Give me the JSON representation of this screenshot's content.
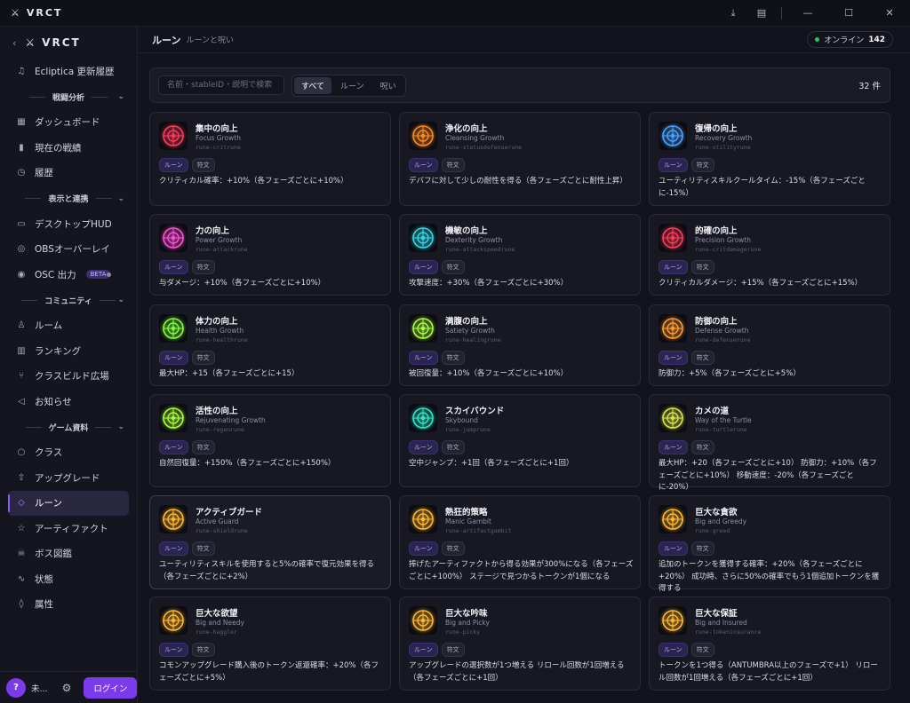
{
  "window": {
    "title": "VRCT"
  },
  "sidebar": {
    "brand": "VRCT",
    "top_item": "Ecliptica 更新履歴",
    "sections": [
      {
        "title": "戦闘分析",
        "items": [
          "ダッシュボード",
          "現在の戦績",
          "履歴"
        ]
      },
      {
        "title": "表示と連携",
        "items": [
          "デスクトップHUD",
          "OBSオーバーレイ",
          "OSC 出力"
        ]
      },
      {
        "title": "コミュニティ",
        "items": [
          "ルーム",
          "ランキング",
          "クラスビルド広場",
          "お知らせ"
        ]
      },
      {
        "title": "ゲーム資料",
        "items": [
          "クラス",
          "アップグレード",
          "ルーン",
          "アーティファクト",
          "ボス図鑑",
          "状態",
          "属性"
        ]
      }
    ],
    "beta_badge": "BETA",
    "footer": {
      "avatar": "?",
      "user": "未...",
      "login": "ログイン"
    }
  },
  "header": {
    "title": "ルーン",
    "subtitle": "ルーンと呪い",
    "online_label": "オンライン",
    "online_count": "142"
  },
  "filter": {
    "placeholder": "名前・stableID・説明で検索",
    "segments": [
      "すべて",
      "ルーン",
      "呪い"
    ],
    "count": "32 件"
  },
  "tag_labels": {
    "rune": "ルーン",
    "kind": "符文"
  },
  "cards": [
    {
      "name": "集中の向上",
      "en": "Focus Growth",
      "id": "rune-critrune",
      "desc": "クリティカル確率：+10%（各フェーズごとに+10%）"
    },
    {
      "name": "浄化の向上",
      "en": "Cleansing Growth",
      "id": "rune-statusdefenserune",
      "desc": "デバフに対して少しの耐性を得る（各フェーズごとに耐性上昇）"
    },
    {
      "name": "復帰の向上",
      "en": "Recovery Growth",
      "id": "rune-utilityrune",
      "desc": "ユーティリティスキルクールタイム：-15%（各フェーズごとに-15%）"
    },
    {
      "name": "力の向上",
      "en": "Power Growth",
      "id": "rune-attackrune",
      "desc": "与ダメージ：+10%（各フェーズごとに+10%）"
    },
    {
      "name": "機敏の向上",
      "en": "Dexterity Growth",
      "id": "rune-attackspeedrune",
      "desc": "攻撃速度：+30%（各フェーズごとに+30%）"
    },
    {
      "name": "的確の向上",
      "en": "Precision Growth",
      "id": "rune-critdamagerune",
      "desc": "クリティカルダメージ：+15%（各フェーズごとに+15%）"
    },
    {
      "name": "体力の向上",
      "en": "Health Growth",
      "id": "rune-healthrune",
      "desc": "最大HP：+15（各フェーズごとに+15）"
    },
    {
      "name": "満腹の向上",
      "en": "Satiety Growth",
      "id": "rune-healingrune",
      "desc": "被回復量：+10%（各フェーズごとに+10%）"
    },
    {
      "name": "防御の向上",
      "en": "Defense Growth",
      "id": "rune-defenserune",
      "desc": "防御力：+5%（各フェーズごとに+5%）"
    },
    {
      "name": "活性の向上",
      "en": "Rejuvenating Growth",
      "id": "rune-regenrune",
      "desc": "自然回復量：+150%（各フェーズごとに+150%）"
    },
    {
      "name": "スカイバウンド",
      "en": "Skybound",
      "id": "rune-jumprune",
      "desc": "空中ジャンプ：+1回（各フェーズごとに+1回）"
    },
    {
      "name": "カメの道",
      "en": "Way of the Turtle",
      "id": "rune-turtlerune",
      "desc": "最大HP：+20（各フェーズごとに+10） 防御力：+10%（各フェーズごとに+10%） 移動速度：-20%（各フェーズごとに-20%）"
    },
    {
      "name": "アクティブガード",
      "en": "Active Guard",
      "id": "rune-shieldrune",
      "desc": "ユーティリティスキルを使用すると5%の確率で復元効果を得る（各フェーズごとに+2%）"
    },
    {
      "name": "熱狂的策略",
      "en": "Manic Gambit",
      "id": "rune-artifactgambit",
      "desc": "捧げたアーティファクトから得る効果が300%になる（各フェーズごとに+100%） ステージで見つかるトークンが1個になる"
    },
    {
      "name": "巨大な貪欲",
      "en": "Big and Greedy",
      "id": "rune-greed",
      "desc": "追加のトークンを獲得する確率：+20%（各フェーズごとに+20%） 成功時、さらに50%の確率でもう1個追加トークンを獲得する"
    },
    {
      "name": "巨大な欲望",
      "en": "Big and Needy",
      "id": "rune-haggler",
      "desc": "コモンアップグレード購入後のトークン返還確率：+20%（各フェーズごとに+5%）"
    },
    {
      "name": "巨大な吟味",
      "en": "Big and Picky",
      "id": "rune-picky",
      "desc": "アップグレードの選択数が1つ増える リロール回数が1回増える（各フェーズごとに+1回）"
    },
    {
      "name": "巨大な保証",
      "en": "Big and Insured",
      "id": "rune-tokeninsurance",
      "desc": "トークンを1つ得る（ANTUMBRA以上のフェーズで+1） リロール回数が1回増える（各フェーズごとに+1回）"
    }
  ],
  "icon_colors": [
    "#ff3b5c",
    "#ff8a1e",
    "#4aa3ff",
    "#ff4fd8",
    "#2fd9e6",
    "#ff3b5c",
    "#7dff3b",
    "#a8ff3b",
    "#ff9a2e",
    "#a8ff3b",
    "#2fe6c8",
    "#d8e64a",
    "#ffb82e",
    "#ffb82e",
    "#ffb82e",
    "#ffb82e",
    "#ffb82e",
    "#ffb82e"
  ]
}
